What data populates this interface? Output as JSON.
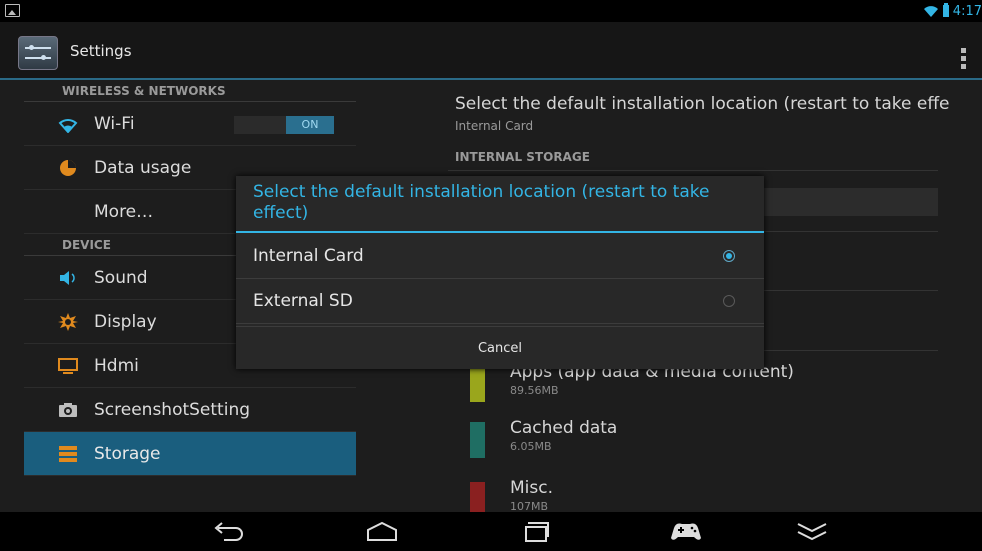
{
  "status_bar": {
    "time": "4:17",
    "icons": [
      "gallery-icon",
      "wifi-icon",
      "battery-icon"
    ]
  },
  "action_bar": {
    "title": "Settings",
    "icons": [
      "settings-app-icon",
      "overflow-menu-icon"
    ]
  },
  "sidebar": {
    "sections": [
      {
        "header": "WIRELESS & NETWORKS",
        "items": [
          {
            "label": "Wi-Fi",
            "icon": "wifi-icon",
            "toggle": "ON"
          },
          {
            "label": "Data usage",
            "icon": "data-usage-icon"
          },
          {
            "label": "More…",
            "icon": ""
          }
        ]
      },
      {
        "header": "DEVICE",
        "items": [
          {
            "label": "Sound",
            "icon": "speaker-icon"
          },
          {
            "label": "Display",
            "icon": "brightness-icon"
          },
          {
            "label": "Hdmi",
            "icon": "monitor-icon"
          },
          {
            "label": "ScreenshotSetting",
            "icon": "camera-icon"
          },
          {
            "label": "Storage",
            "icon": "storage-icon",
            "selected": true
          }
        ]
      }
    ]
  },
  "detail": {
    "title": "Select the default installation location (restart to take effect)",
    "subtitle": "Internal Card",
    "section": "INTERNAL STORAGE",
    "storage_items": [
      {
        "name": "Apps (app data & media content)",
        "size": "89.56MB",
        "color": "#9aa61c"
      },
      {
        "name": "Cached data",
        "size": "6.05MB",
        "color": "#1f6e63"
      },
      {
        "name": "Misc.",
        "size": "107MB",
        "color": "#8a2020"
      }
    ]
  },
  "dialog": {
    "title": "Select the default installation location (restart to take effect)",
    "options": [
      {
        "label": "Internal Card",
        "selected": true
      },
      {
        "label": "External SD",
        "selected": false
      }
    ],
    "cancel_label": "Cancel"
  },
  "nav_bar": {
    "buttons": [
      "back-icon",
      "home-icon",
      "recent-apps-icon",
      "gamepad-icon",
      "hide-bar-icon"
    ]
  },
  "colors": {
    "accent": "#33b5e5",
    "selected_row": "#1a5e7e",
    "dialog_bg": "#282828"
  }
}
